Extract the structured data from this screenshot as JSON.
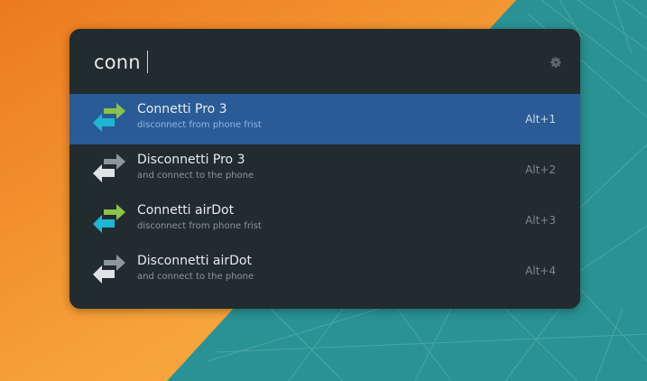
{
  "search": {
    "query": "conn"
  },
  "results": [
    {
      "title": "Connetti Pro 3",
      "subtitle": "disconnect from phone frist",
      "shortcut": "Alt+1",
      "icon": "connect-arrows-icon",
      "selected": true
    },
    {
      "title": "Disconnetti Pro 3",
      "subtitle": "and connect to the phone",
      "shortcut": "Alt+2",
      "icon": "disconnect-arrows-icon",
      "selected": false
    },
    {
      "title": "Connetti airDot",
      "subtitle": "disconnect from phone frist",
      "shortcut": "Alt+3",
      "icon": "connect-arrows-icon",
      "selected": false
    },
    {
      "title": "Disconnetti airDot",
      "subtitle": "and connect to the phone",
      "shortcut": "Alt+4",
      "icon": "disconnect-arrows-icon",
      "selected": false
    }
  ],
  "colors": {
    "panel": "#222b2e",
    "selection": "#2a5b96",
    "wallpaper_orange": "#f39a2d",
    "wallpaper_teal": "#2a9294",
    "arrow_green": "#8bc34a",
    "arrow_cyan": "#1fb5d4",
    "arrow_gray": "#a9b3b7"
  }
}
